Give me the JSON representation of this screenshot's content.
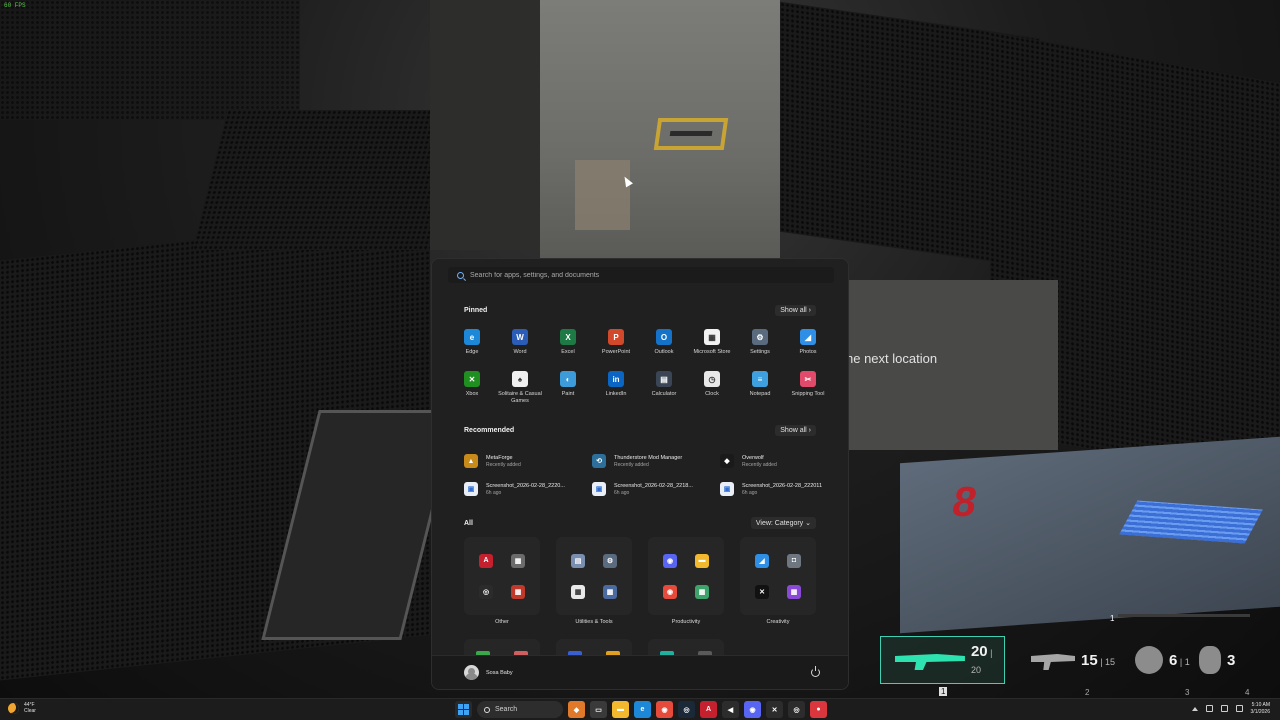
{
  "game": {
    "fps": "60 FPS",
    "objective": "he next location",
    "floor_number": "8",
    "hud": {
      "slot1": {
        "ammo": "20",
        "reserve": "20",
        "key": "1"
      },
      "slot2": {
        "ammo": "15",
        "reserve": "15",
        "key": "2"
      },
      "slot3": {
        "ammo": "6",
        "reserve": "1",
        "key": "3"
      },
      "slot4": {
        "count": "3",
        "key": "4"
      },
      "health_marker": "1"
    }
  },
  "start_menu": {
    "search": {
      "placeholder": "Search for apps, settings, and documents"
    },
    "pinned": {
      "title": "Pinned",
      "show_all": "Show all  ›",
      "apps": [
        {
          "label": "Edge",
          "icon": "edge-icon",
          "color": "#1e88d8",
          "glyph": "e"
        },
        {
          "label": "Word",
          "icon": "word-icon",
          "color": "#2b5cb8",
          "glyph": "W"
        },
        {
          "label": "Excel",
          "icon": "excel-icon",
          "color": "#1d7a45",
          "glyph": "X"
        },
        {
          "label": "PowerPoint",
          "icon": "powerpoint-icon",
          "color": "#d1482a",
          "glyph": "P"
        },
        {
          "label": "Outlook",
          "icon": "outlook-icon",
          "color": "#1473c9",
          "glyph": "O"
        },
        {
          "label": "Microsoft Store",
          "icon": "store-icon",
          "color": "#f2f2f2",
          "glyph": "▦"
        },
        {
          "label": "Settings",
          "icon": "gear-icon",
          "color": "#5a6b80",
          "glyph": "⚙"
        },
        {
          "label": "Photos",
          "icon": "photos-icon",
          "color": "#2f8fe6",
          "glyph": "◢"
        },
        {
          "label": "Xbox",
          "icon": "xbox-icon",
          "color": "#1f8f1f",
          "glyph": "✕"
        },
        {
          "label": "Solitaire & Casual Games",
          "icon": "solitaire-icon",
          "color": "#f0f0f0",
          "glyph": "♠"
        },
        {
          "label": "Paint",
          "icon": "paint-icon",
          "color": "#3c9bd8",
          "glyph": "◐"
        },
        {
          "label": "LinkedIn",
          "icon": "linkedin-icon",
          "color": "#0a66c2",
          "glyph": "in"
        },
        {
          "label": "Calculator",
          "icon": "calculator-icon",
          "color": "#3a4655",
          "glyph": "▤"
        },
        {
          "label": "Clock",
          "icon": "clock-icon",
          "color": "#e8e8e8",
          "glyph": "◷"
        },
        {
          "label": "Notepad",
          "icon": "notepad-icon",
          "color": "#3fa0e0",
          "glyph": "≡"
        },
        {
          "label": "Snipping Tool",
          "icon": "snipping-tool-icon",
          "color": "#e24a6b",
          "glyph": "✂"
        }
      ]
    },
    "recommended": {
      "title": "Recommended",
      "show_all": "Show all  ›",
      "items": [
        {
          "name": "MetaForge",
          "sub": "Recently added",
          "icon": "metaforge-icon",
          "color": "#c98a1c",
          "glyph": "▲"
        },
        {
          "name": "Thunderstore Mod Manager",
          "sub": "Recently added",
          "icon": "thunderstore-icon",
          "color": "#2b6f9a",
          "glyph": "⟲"
        },
        {
          "name": "Overwolf",
          "sub": "Recently added",
          "icon": "overwolf-icon",
          "color": "#1a1a1a",
          "glyph": "◆"
        },
        {
          "name": "Screenshot_2026-02-28_2220...",
          "sub": "6h ago",
          "icon": "image-file-icon",
          "color": "#e9eef7",
          "glyph": "▣"
        },
        {
          "name": "Screenshot_2026-02-28_2218...",
          "sub": "6h ago",
          "icon": "image-file-icon",
          "color": "#e9eef7",
          "glyph": "▣"
        },
        {
          "name": "Screenshot_2026-02-28_222011",
          "sub": "6h ago",
          "icon": "image-file-icon",
          "color": "#e9eef7",
          "glyph": "▣"
        }
      ]
    },
    "all": {
      "title": "All",
      "view": "View: Category  ⌄",
      "categories": [
        {
          "label": "Other",
          "icons": [
            {
              "icon": "adobe-icon",
              "color": "#c5202e",
              "glyph": "A"
            },
            {
              "icon": "app-window-icon",
              "color": "#6b6b6b",
              "glyph": "▦"
            },
            {
              "icon": "github-icon",
              "color": "#2b2b2b",
              "glyph": "◎"
            },
            {
              "icon": "games-folder-icon",
              "color": "#c0392b",
              "glyph": "▦"
            }
          ]
        },
        {
          "label": "Utilities & Tools",
          "icons": [
            {
              "icon": "control-panel-icon",
              "color": "#7a8fb0",
              "glyph": "▤"
            },
            {
              "icon": "gear-icon",
              "color": "#5a6b80",
              "glyph": "⚙"
            },
            {
              "icon": "store-icon",
              "color": "#e9e9e9",
              "glyph": "▦"
            },
            {
              "icon": "tools-folder-icon",
              "color": "#4b6aa0",
              "glyph": "▦"
            }
          ]
        },
        {
          "label": "Productivity",
          "icons": [
            {
              "icon": "discord-icon",
              "color": "#5865f2",
              "glyph": "◉"
            },
            {
              "icon": "file-explorer-icon",
              "color": "#f2b92e",
              "glyph": "▬"
            },
            {
              "icon": "chrome-icon",
              "color": "#e64a3b",
              "glyph": "◉"
            },
            {
              "icon": "productivity-folder-icon",
              "color": "#3ea36b",
              "glyph": "▦"
            }
          ]
        },
        {
          "label": "Creativity",
          "icons": [
            {
              "icon": "photos-icon",
              "color": "#2f8fe6",
              "glyph": "◢"
            },
            {
              "icon": "camera-icon",
              "color": "#6e7680",
              "glyph": "◘"
            },
            {
              "icon": "capcut-icon",
              "color": "#111111",
              "glyph": "✕"
            },
            {
              "icon": "creativity-folder-icon",
              "color": "#8a4ad8",
              "glyph": "▦"
            }
          ]
        }
      ],
      "second_row_colors": [
        [
          "#3aa84a",
          "#d06060"
        ],
        [
          "#3a5ed0",
          "#e0a020"
        ],
        [
          "#20b0a0",
          "#5a5a5a"
        ],
        []
      ]
    },
    "user": {
      "name": "Sosa Baby"
    }
  },
  "taskbar": {
    "weather": {
      "temp": "44°F",
      "cond": "Clear"
    },
    "search_label": "Search",
    "apps": [
      {
        "icon": "pinned-app-icon",
        "color": "#e07a2a",
        "glyph": "◆"
      },
      {
        "icon": "task-view-icon",
        "color": "#3a3a3a",
        "glyph": "▭"
      },
      {
        "icon": "file-explorer-icon",
        "color": "#f2b92e",
        "glyph": "▬"
      },
      {
        "icon": "edge-icon",
        "color": "#1e88d8",
        "glyph": "e"
      },
      {
        "icon": "chrome-icon",
        "color": "#e64a3b",
        "glyph": "◉"
      },
      {
        "icon": "steam-icon",
        "color": "#1b2838",
        "glyph": "◎"
      },
      {
        "icon": "adobe-icon",
        "color": "#c5202e",
        "glyph": "A"
      },
      {
        "icon": "epic-icon",
        "color": "#2c2c2c",
        "glyph": "◀"
      },
      {
        "icon": "discord-icon",
        "color": "#5865f2",
        "glyph": "◉"
      },
      {
        "icon": "xbox-app-icon",
        "color": "#2c2c2c",
        "glyph": "✕"
      },
      {
        "icon": "obs-icon",
        "color": "#2c2c2c",
        "glyph": "◎"
      },
      {
        "icon": "record-icon",
        "color": "#d9363e",
        "glyph": "●"
      }
    ],
    "clock": {
      "time": "5:10 AM",
      "date": "3/1/2026"
    }
  }
}
